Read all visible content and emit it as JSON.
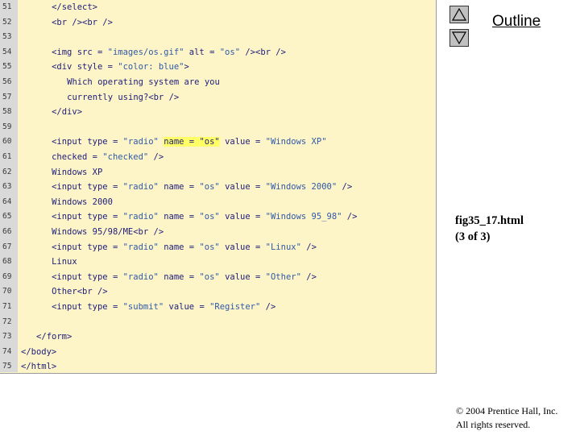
{
  "code_lines": [
    {
      "num": "51",
      "indent": 4,
      "segments": [
        {
          "t": "</select>",
          "c": "kw"
        }
      ]
    },
    {
      "num": "52",
      "indent": 4,
      "segments": [
        {
          "t": "<br /><br />",
          "c": "kw"
        }
      ]
    },
    {
      "num": "53",
      "indent": 0,
      "segments": []
    },
    {
      "num": "54",
      "indent": 4,
      "segments": [
        {
          "t": "<img src = ",
          "c": "kw"
        },
        {
          "t": "\"images/os.gif\"",
          "c": "str"
        },
        {
          "t": " alt = ",
          "c": "kw"
        },
        {
          "t": "\"os\"",
          "c": "str"
        },
        {
          "t": " /><br />",
          "c": "kw"
        }
      ]
    },
    {
      "num": "55",
      "indent": 4,
      "segments": [
        {
          "t": "<div style = ",
          "c": "kw"
        },
        {
          "t": "\"color: blue\"",
          "c": "str"
        },
        {
          "t": ">",
          "c": "kw"
        }
      ]
    },
    {
      "num": "56",
      "indent": 6,
      "segments": [
        {
          "t": "Which operating system are you",
          "c": "kw"
        }
      ]
    },
    {
      "num": "57",
      "indent": 6,
      "segments": [
        {
          "t": "currently using?<br />",
          "c": "kw"
        }
      ]
    },
    {
      "num": "58",
      "indent": 4,
      "segments": [
        {
          "t": "</div>",
          "c": "kw"
        }
      ]
    },
    {
      "num": "59",
      "indent": 0,
      "segments": []
    },
    {
      "num": "60",
      "indent": 4,
      "segments": [
        {
          "t": "<input type = ",
          "c": "kw"
        },
        {
          "t": "\"radio\"",
          "c": "str"
        },
        {
          "t": " ",
          "c": "kw"
        },
        {
          "t": "name = \"os\"",
          "c": "hl"
        },
        {
          "t": " value = ",
          "c": "kw"
        },
        {
          "t": "\"Windows XP\"",
          "c": "str"
        }
      ]
    },
    {
      "num": "61",
      "indent": 4,
      "segments": [
        {
          "t": "checked = ",
          "c": "kw"
        },
        {
          "t": "\"checked\"",
          "c": "str"
        },
        {
          "t": " />",
          "c": "kw"
        }
      ]
    },
    {
      "num": "62",
      "indent": 4,
      "segments": [
        {
          "t": "Windows XP",
          "c": "kw"
        }
      ]
    },
    {
      "num": "63",
      "indent": 4,
      "segments": [
        {
          "t": "<input type = ",
          "c": "kw"
        },
        {
          "t": "\"radio\"",
          "c": "str"
        },
        {
          "t": " name = ",
          "c": "kw"
        },
        {
          "t": "\"os\"",
          "c": "str"
        },
        {
          "t": " value = ",
          "c": "kw"
        },
        {
          "t": "\"Windows 2000\"",
          "c": "str"
        },
        {
          "t": " />",
          "c": "kw"
        }
      ]
    },
    {
      "num": "64",
      "indent": 4,
      "segments": [
        {
          "t": "Windows 2000",
          "c": "kw"
        }
      ]
    },
    {
      "num": "65",
      "indent": 4,
      "segments": [
        {
          "t": "<input type = ",
          "c": "kw"
        },
        {
          "t": "\"radio\"",
          "c": "str"
        },
        {
          "t": " name = ",
          "c": "kw"
        },
        {
          "t": "\"os\"",
          "c": "str"
        },
        {
          "t": " value = ",
          "c": "kw"
        },
        {
          "t": "\"Windows 95_98\"",
          "c": "str"
        },
        {
          "t": " />",
          "c": "kw"
        }
      ]
    },
    {
      "num": "66",
      "indent": 4,
      "segments": [
        {
          "t": "Windows 95/98/ME<br />",
          "c": "kw"
        }
      ]
    },
    {
      "num": "67",
      "indent": 4,
      "segments": [
        {
          "t": "<input type = ",
          "c": "kw"
        },
        {
          "t": "\"radio\"",
          "c": "str"
        },
        {
          "t": " name = ",
          "c": "kw"
        },
        {
          "t": "\"os\"",
          "c": "str"
        },
        {
          "t": " value = ",
          "c": "kw"
        },
        {
          "t": "\"Linux\"",
          "c": "str"
        },
        {
          "t": " />",
          "c": "kw"
        }
      ]
    },
    {
      "num": "68",
      "indent": 4,
      "segments": [
        {
          "t": "Linux",
          "c": "kw"
        }
      ]
    },
    {
      "num": "69",
      "indent": 4,
      "segments": [
        {
          "t": "<input type = ",
          "c": "kw"
        },
        {
          "t": "\"radio\"",
          "c": "str"
        },
        {
          "t": " name = ",
          "c": "kw"
        },
        {
          "t": "\"os\"",
          "c": "str"
        },
        {
          "t": " value = ",
          "c": "kw"
        },
        {
          "t": "\"Other\"",
          "c": "str"
        },
        {
          "t": " />",
          "c": "kw"
        }
      ]
    },
    {
      "num": "70",
      "indent": 4,
      "segments": [
        {
          "t": "Other<br />",
          "c": "kw"
        }
      ]
    },
    {
      "num": "71",
      "indent": 4,
      "segments": [
        {
          "t": "<input type = ",
          "c": "kw"
        },
        {
          "t": "\"submit\"",
          "c": "str"
        },
        {
          "t": " value = ",
          "c": "kw"
        },
        {
          "t": "\"Register\"",
          "c": "str"
        },
        {
          "t": " />",
          "c": "kw"
        }
      ]
    },
    {
      "num": "72",
      "indent": 0,
      "segments": []
    },
    {
      "num": "73",
      "indent": 2,
      "segments": [
        {
          "t": "</form>",
          "c": "kw"
        }
      ]
    },
    {
      "num": "74",
      "indent": 0,
      "segments": [
        {
          "t": "</body>",
          "c": "kw"
        }
      ]
    },
    {
      "num": "75",
      "indent": 0,
      "segments": [
        {
          "t": "</html>",
          "c": "kw"
        }
      ]
    }
  ],
  "nav": {
    "up_icon": "triangle-up-icon",
    "down_icon": "triangle-down-icon"
  },
  "outline_title": "Outline",
  "file_label": {
    "name": "fig35_17.html",
    "page": "(3 of 3)"
  },
  "copyright": {
    "line1": "© 2004 Prentice Hall, Inc.",
    "line2": "All rights reserved."
  },
  "colors": {
    "code_background": "#fdf4c8",
    "gutter": "#d9d9d9",
    "highlight": "#ffff66",
    "code_text": "#1d1d7a",
    "string_text": "#2f5aa8"
  }
}
